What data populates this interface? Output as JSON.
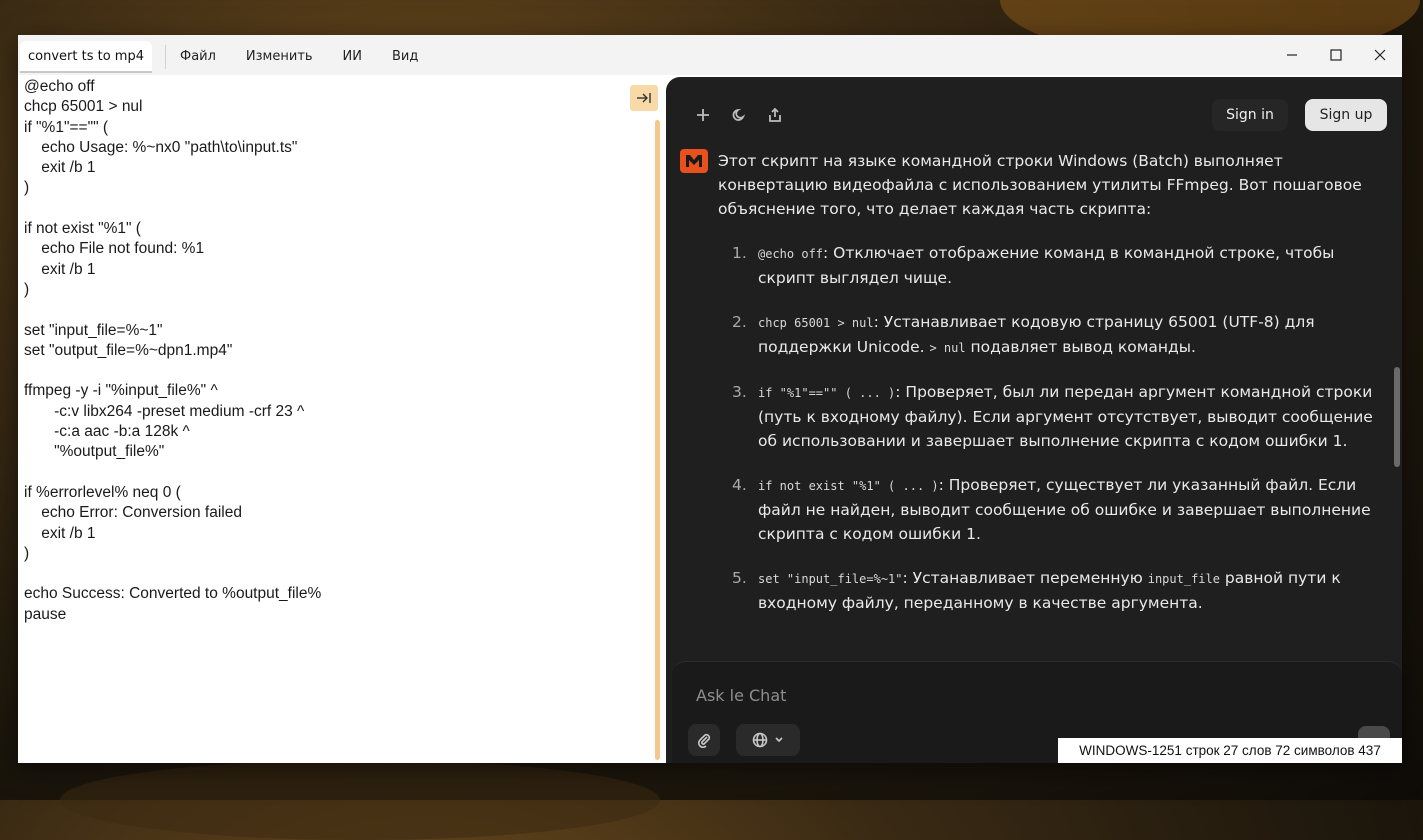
{
  "window": {
    "doc_tab": "convert ts to mp4",
    "menu": [
      "Файл",
      "Изменить",
      "ИИ",
      "Вид"
    ]
  },
  "editor": {
    "lines": [
      "@echo off",
      "chcp 65001 > nul",
      "if \"%1\"==\"\" (",
      "    echo Usage: %~nx0 \"path\\to\\input.ts\"",
      "    exit /b 1",
      ")",
      "",
      "if not exist \"%1\" (",
      "    echo File not found: %1",
      "    exit /b 1",
      ")",
      "",
      "set \"input_file=%~1\"",
      "set \"output_file=%~dpn1.mp4\"",
      "",
      "ffmpeg -y -i \"%input_file%\" ^",
      "       -c:v libx264 -preset medium -crf 23 ^",
      "       -c:a aac -b:a 128k ^",
      "       \"%output_file%\"",
      "",
      "if %errorlevel% neq 0 (",
      "    echo Error: Conversion failed",
      "    exit /b 1",
      ")",
      "",
      "echo Success: Converted to %output_file%",
      "pause"
    ]
  },
  "chat": {
    "sign_in": "Sign in",
    "sign_up": "Sign up",
    "intro": "Этот скрипт на языке командной строки Windows (Batch) выполняет конвертацию видеофайла с использованием утилиты FFmpeg. Вот пошаговое объяснение того, что делает каждая часть скрипта:",
    "items": [
      {
        "num": "1.",
        "code": "@echo off",
        "text": ": Отключает отображение команд в командной строке, чтобы скрипт выглядел чище."
      },
      {
        "num": "2.",
        "code": "chcp 65001 > nul",
        "text": ": Устанавливает кодовую страницу 65001 (UTF-8) для поддержки Unicode. ",
        "code2": "> nul",
        "text2": " подавляет вывод команды."
      },
      {
        "num": "3.",
        "code": "if \"%1\"==\"\" ( ... )",
        "text": ": Проверяет, был ли передан аргумент командной строки (путь к входному файлу). Если аргумент отсутствует, выводит сообщение об использовании и завершает выполнение скрипта с кодом ошибки 1."
      },
      {
        "num": "4.",
        "code": "if not exist \"%1\" ( ... )",
        "text": ": Проверяет, существует ли указанный файл. Если файл не найден, выводит сообщение об ошибке и завершает выполнение скрипта с кодом ошибки 1."
      },
      {
        "num": "5.",
        "code": "set \"input_file=%~1\"",
        "text": ": Устанавливает переменную ",
        "code2": "input_file",
        "text2": " равной пути к входному файлу, переданному в качестве аргумента."
      }
    ],
    "input_placeholder": "Ask le Chat"
  },
  "status": "WINDOWS-1251 строк 27 слов 72 символов 437"
}
